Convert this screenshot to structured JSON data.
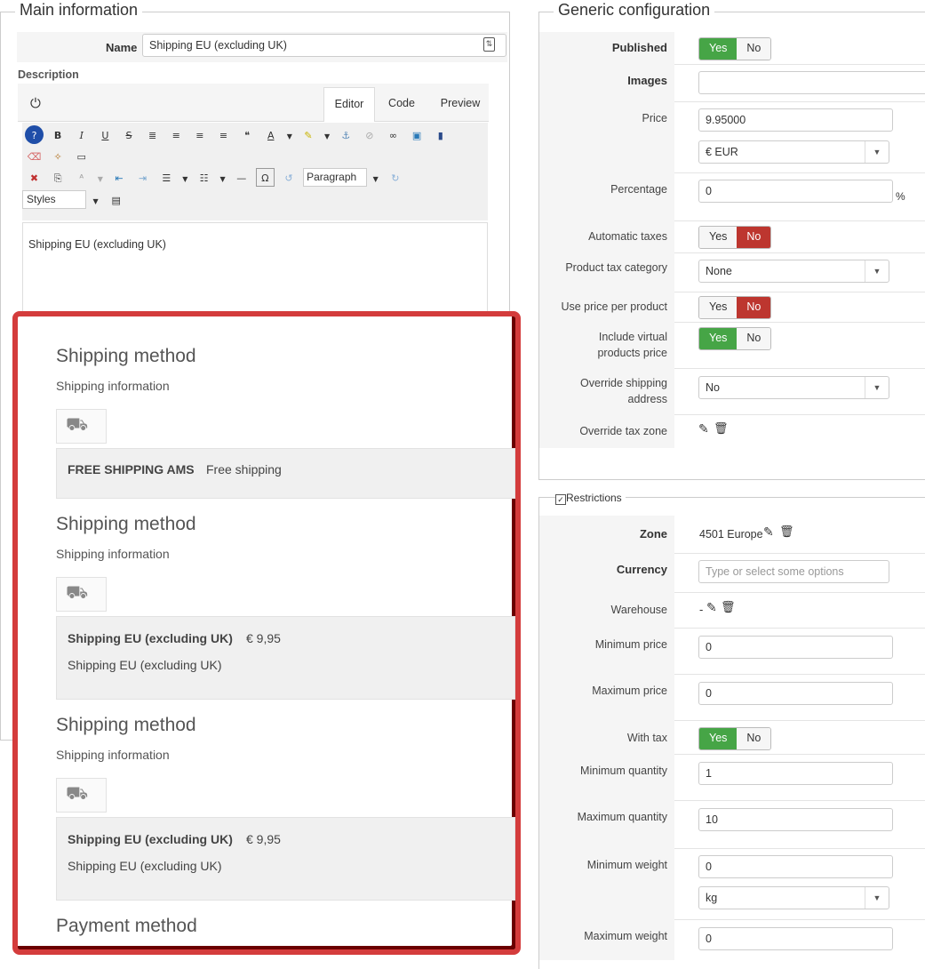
{
  "main": {
    "legend": "Main information",
    "name_label": "Name",
    "name_value": "Shipping EU (excluding UK)",
    "description_label": "Description",
    "tabs": [
      "Editor",
      "Code",
      "Preview"
    ],
    "format_value": "Paragraph",
    "styles_value": "Styles",
    "editor_text": "Shipping EU (excluding UK)"
  },
  "popup": {
    "sections": [
      {
        "title": "Shipping method",
        "subtitle": "Shipping information",
        "name": "FREE SHIPPING AMS",
        "extra": "Free shipping",
        "price": "",
        "desc": ""
      },
      {
        "title": "Shipping method",
        "subtitle": "Shipping information",
        "name": "Shipping EU (excluding UK)",
        "extra": "",
        "price": "€ 9,95",
        "desc": "Shipping EU (excluding UK)"
      },
      {
        "title": "Shipping method",
        "subtitle": "Shipping information",
        "name": "Shipping EU (excluding UK)",
        "extra": "",
        "price": "€ 9,95",
        "desc": "Shipping EU (excluding UK)"
      }
    ],
    "payment_title": "Payment method"
  },
  "generic": {
    "legend": "Generic configuration",
    "published_label": "Published",
    "images_label": "Images",
    "price_label": "Price",
    "price_value": "9.95000",
    "currency_value": "€ EUR",
    "percentage_label": "Percentage",
    "percentage_value": "0",
    "percent_sign": "%",
    "auto_taxes_label": "Automatic taxes",
    "tax_category_label": "Product tax category",
    "tax_category_value": "None",
    "price_per_product_label": "Use price per product",
    "include_virtual_label": "Include virtual products price",
    "override_address_label": "Override shipping address",
    "override_address_value": "No",
    "override_tax_label": "Override tax zone",
    "yes": "Yes",
    "no": "No"
  },
  "restrictions": {
    "legend": "Restrictions",
    "zone_label": "Zone",
    "zone_value": "4501 Europe",
    "currency_label": "Currency",
    "currency_placeholder": "Type or select some options",
    "warehouse_label": "Warehouse",
    "warehouse_value": "-",
    "min_price_label": "Minimum price",
    "min_price_value": "0",
    "max_price_label": "Maximum price",
    "max_price_value": "0",
    "with_tax_label": "With tax",
    "min_qty_label": "Minimum quantity",
    "min_qty_value": "1",
    "max_qty_label": "Maximum quantity",
    "max_qty_value": "10",
    "min_weight_label": "Minimum weight",
    "min_weight_value": "0",
    "weight_unit_value": "kg",
    "max_weight_label": "Maximum weight",
    "max_weight_value": "0"
  },
  "colors": {
    "green": "#46a546",
    "red": "#bd362f",
    "popup_border": "#d43c3c"
  }
}
